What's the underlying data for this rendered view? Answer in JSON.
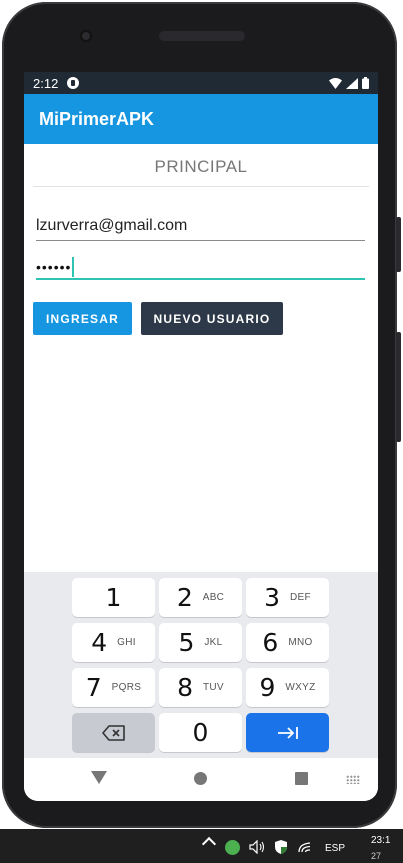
{
  "status_bar": {
    "time": "2:12"
  },
  "app_bar": {
    "title": "MiPrimerAPK"
  },
  "main": {
    "page_title": "PRINCIPAL",
    "email_value": "lzurverra@gmail.com",
    "password_value": "••••••",
    "login_button": "INGRESAR",
    "new_user_button": "NUEVO USUARIO"
  },
  "keyboard": {
    "keys": [
      {
        "num": "1",
        "letters": ""
      },
      {
        "num": "2",
        "letters": "ABC"
      },
      {
        "num": "3",
        "letters": "DEF"
      },
      {
        "num": "4",
        "letters": "GHI"
      },
      {
        "num": "5",
        "letters": "JKL"
      },
      {
        "num": "6",
        "letters": "MNO"
      },
      {
        "num": "7",
        "letters": "PQRS"
      },
      {
        "num": "8",
        "letters": "TUV"
      },
      {
        "num": "9",
        "letters": "WXYZ"
      },
      {
        "num": "0",
        "letters": ""
      }
    ]
  },
  "taskbar": {
    "language": "ESP",
    "time": "23:1",
    "date": "27"
  },
  "colors": {
    "accent": "#1696e0",
    "dark_button": "#2d3848",
    "focus": "#2fc3b3",
    "enter_key": "#1a73e8"
  }
}
